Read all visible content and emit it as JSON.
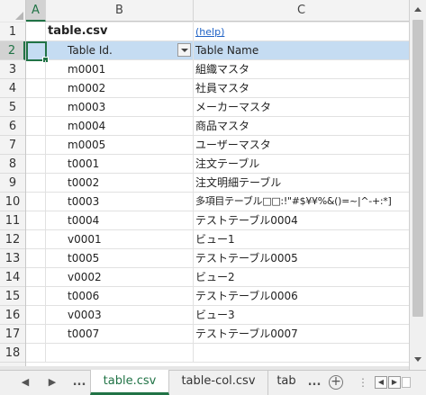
{
  "columns": {
    "a": "A",
    "b": "B",
    "c": "C"
  },
  "rows": [
    {
      "num": "1"
    },
    {
      "num": "2"
    },
    {
      "num": "3"
    },
    {
      "num": "4"
    },
    {
      "num": "5"
    },
    {
      "num": "6"
    },
    {
      "num": "7"
    },
    {
      "num": "8"
    },
    {
      "num": "9"
    },
    {
      "num": "10"
    },
    {
      "num": "11"
    },
    {
      "num": "12"
    },
    {
      "num": "13"
    },
    {
      "num": "14"
    },
    {
      "num": "15"
    },
    {
      "num": "16"
    },
    {
      "num": "17"
    },
    {
      "num": "18"
    }
  ],
  "title_row": {
    "filename": "table.csv",
    "help_link": "(help)"
  },
  "header_row": {
    "col_b": "Table Id.",
    "col_c": "Table Name"
  },
  "data_rows": [
    {
      "id": "m0001",
      "name": "組織マスタ"
    },
    {
      "id": "m0002",
      "name": "社員マスタ"
    },
    {
      "id": "m0003",
      "name": "メーカーマスタ"
    },
    {
      "id": "m0004",
      "name": "商品マスタ"
    },
    {
      "id": "m0005",
      "name": "ユーザーマスタ"
    },
    {
      "id": "t0001",
      "name": "注文テーブル"
    },
    {
      "id": "t0002",
      "name": "注文明細テーブル"
    },
    {
      "id": "t0003",
      "name": "多項目テーブル□□:!\"#$¥¥%&()=~|^-+:*]"
    },
    {
      "id": "t0004",
      "name": "テストテーブル0004"
    },
    {
      "id": "v0001",
      "name": "ビュー1"
    },
    {
      "id": "t0005",
      "name": "テストテーブル0005"
    },
    {
      "id": "v0002",
      "name": "ビュー2"
    },
    {
      "id": "t0006",
      "name": "テストテーブル0006"
    },
    {
      "id": "v0003",
      "name": "ビュー3"
    },
    {
      "id": "t0007",
      "name": "テストテーブル0007"
    }
  ],
  "tabs": [
    {
      "label": "table.csv",
      "active": true
    },
    {
      "label": "table-col.csv",
      "active": false
    },
    {
      "label": "tab",
      "active": false
    }
  ],
  "tabbar": {
    "ellipsis": "...",
    "prev": "◀",
    "next": "▶"
  },
  "colors": {
    "accent": "#217346",
    "header_fill": "#c5dcf2",
    "link": "#1f62c6"
  }
}
